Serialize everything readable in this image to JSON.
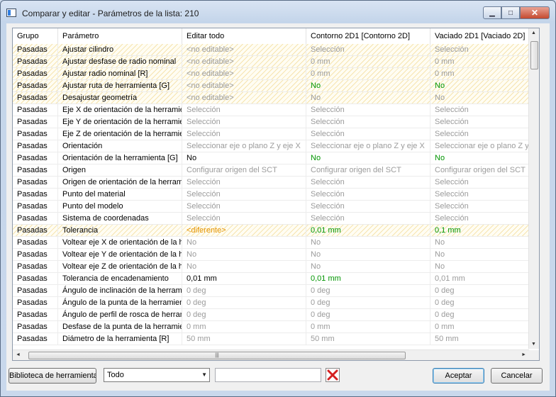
{
  "window": {
    "title": "Comparar y editar - Parámetros de la lista: 210",
    "minimize_label": "▁",
    "maximize_label": "□",
    "close_label": "✕"
  },
  "table": {
    "columns": [
      "Grupo",
      "Parámetro",
      "Editar todo",
      "Contorno 2D1 [Contorno 2D]",
      "Vaciado 2D1 [Vaciado 2D]"
    ],
    "rows": [
      {
        "cells": [
          "Pasadas",
          "Ajustar cilindro",
          "<no editable>",
          "Selección",
          "Selección"
        ],
        "styles": [
          "black",
          "black",
          "gray",
          "gray",
          "gray"
        ],
        "hatched": true
      },
      {
        "cells": [
          "Pasadas",
          "Ajustar desfase de radio nominal",
          "<no editable>",
          "0 mm",
          "0 mm"
        ],
        "styles": [
          "black",
          "black",
          "gray",
          "gray",
          "gray"
        ],
        "hatched": true
      },
      {
        "cells": [
          "Pasadas",
          "Ajustar radio nominal [R]",
          "<no editable>",
          "0 mm",
          "0 mm"
        ],
        "styles": [
          "black",
          "black",
          "gray",
          "gray",
          "gray"
        ],
        "hatched": true
      },
      {
        "cells": [
          "Pasadas",
          "Ajustar ruta de herramienta [G]",
          "<no editable>",
          "No",
          "No"
        ],
        "styles": [
          "black",
          "black",
          "gray",
          "green",
          "green"
        ],
        "hatched": true
      },
      {
        "cells": [
          "Pasadas",
          "Desajustar geometría",
          "<no editable>",
          "No",
          "No"
        ],
        "styles": [
          "black",
          "black",
          "gray",
          "gray",
          "gray"
        ],
        "hatched": true
      },
      {
        "cells": [
          "Pasadas",
          "Eje X de orientación de la herramienta",
          "Selección",
          "Selección",
          "Selección"
        ],
        "styles": [
          "black",
          "black",
          "gray",
          "gray",
          "gray"
        ],
        "hatched": false
      },
      {
        "cells": [
          "Pasadas",
          "Eje Y de orientación de la herramienta",
          "Selección",
          "Selección",
          "Selección"
        ],
        "styles": [
          "black",
          "black",
          "gray",
          "gray",
          "gray"
        ],
        "hatched": false
      },
      {
        "cells": [
          "Pasadas",
          "Eje Z de orientación de la herramienta",
          "Selección",
          "Selección",
          "Selección"
        ],
        "styles": [
          "black",
          "black",
          "gray",
          "gray",
          "gray"
        ],
        "hatched": false
      },
      {
        "cells": [
          "Pasadas",
          "Orientación",
          "Seleccionar eje o plano Z y eje X",
          "Seleccionar eje o plano Z y eje X",
          "Seleccionar eje o plano Z y eje X"
        ],
        "styles": [
          "black",
          "black",
          "gray",
          "gray",
          "gray"
        ],
        "hatched": false
      },
      {
        "cells": [
          "Pasadas",
          "Orientación de la herramienta [G]",
          "No",
          "No",
          "No"
        ],
        "styles": [
          "black",
          "black",
          "black",
          "green",
          "green"
        ],
        "hatched": false
      },
      {
        "cells": [
          "Pasadas",
          "Origen",
          "Configurar origen del SCT",
          "Configurar origen del SCT",
          "Configurar origen del SCT"
        ],
        "styles": [
          "black",
          "black",
          "gray",
          "gray",
          "gray"
        ],
        "hatched": false
      },
      {
        "cells": [
          "Pasadas",
          "Origen de orientación de la herramienta",
          "Selección",
          "Selección",
          "Selección"
        ],
        "styles": [
          "black",
          "black",
          "gray",
          "gray",
          "gray"
        ],
        "hatched": false
      },
      {
        "cells": [
          "Pasadas",
          "Punto del material",
          "Selección",
          "Selección",
          "Selección"
        ],
        "styles": [
          "black",
          "black",
          "gray",
          "gray",
          "gray"
        ],
        "hatched": false
      },
      {
        "cells": [
          "Pasadas",
          "Punto del modelo",
          "Selección",
          "Selección",
          "Selección"
        ],
        "styles": [
          "black",
          "black",
          "gray",
          "gray",
          "gray"
        ],
        "hatched": false
      },
      {
        "cells": [
          "Pasadas",
          "Sistema de coordenadas",
          "Selección",
          "Selección",
          "Selección"
        ],
        "styles": [
          "black",
          "black",
          "gray",
          "gray",
          "gray"
        ],
        "hatched": false
      },
      {
        "cells": [
          "Pasadas",
          "Tolerancia",
          "<diferente>",
          "0,01 mm",
          "0,1 mm"
        ],
        "styles": [
          "black",
          "black",
          "orange",
          "green",
          "green"
        ],
        "hatched": true
      },
      {
        "cells": [
          "Pasadas",
          "Voltear eje X de orientación de la herramienta",
          "No",
          "No",
          "No"
        ],
        "styles": [
          "black",
          "black",
          "gray",
          "gray",
          "gray"
        ],
        "hatched": false
      },
      {
        "cells": [
          "Pasadas",
          "Voltear eje Y de orientación de la herramienta",
          "No",
          "No",
          "No"
        ],
        "styles": [
          "black",
          "black",
          "gray",
          "gray",
          "gray"
        ],
        "hatched": false
      },
      {
        "cells": [
          "Pasadas",
          "Voltear eje Z de orientación de la herramienta",
          "No",
          "No",
          "No"
        ],
        "styles": [
          "black",
          "black",
          "gray",
          "gray",
          "gray"
        ],
        "hatched": false
      },
      {
        "cells": [
          "Pasadas",
          "Tolerancia de encadenamiento",
          "0,01 mm",
          "0,01 mm",
          "0,01 mm"
        ],
        "styles": [
          "black",
          "black",
          "black",
          "green",
          "gray"
        ],
        "hatched": false
      },
      {
        "cells": [
          "Pasadas",
          "Ángulo de inclinación de la herramienta",
          "0 deg",
          "0 deg",
          "0 deg"
        ],
        "styles": [
          "black",
          "black",
          "gray",
          "gray",
          "gray"
        ],
        "hatched": false
      },
      {
        "cells": [
          "Pasadas",
          "Ángulo de la punta de la herramienta",
          "0 deg",
          "0 deg",
          "0 deg"
        ],
        "styles": [
          "black",
          "black",
          "gray",
          "gray",
          "gray"
        ],
        "hatched": false
      },
      {
        "cells": [
          "Pasadas",
          "Ángulo de perfil de rosca de herramienta",
          "0 deg",
          "0 deg",
          "0 deg"
        ],
        "styles": [
          "black",
          "black",
          "gray",
          "gray",
          "gray"
        ],
        "hatched": false
      },
      {
        "cells": [
          "Pasadas",
          "Desfase de la punta de la herramienta",
          "0 mm",
          "0 mm",
          "0 mm"
        ],
        "styles": [
          "black",
          "black",
          "gray",
          "gray",
          "gray"
        ],
        "hatched": false
      },
      {
        "cells": [
          "Pasadas",
          "Diámetro de la herramienta [R]",
          "50 mm",
          "50 mm",
          "50 mm"
        ],
        "styles": [
          "black",
          "black",
          "gray",
          "gray",
          "gray"
        ],
        "hatched": false
      }
    ]
  },
  "scrollbars": {
    "up": "▲",
    "down": "▼",
    "left": "◄",
    "right": "►",
    "grip": "|||"
  },
  "footer": {
    "library_button": "Biblioteca de herramientas",
    "filter_select": "Todo",
    "filter_dropdown": "▼",
    "search_value": "",
    "accept_button": "Aceptar",
    "cancel_button": "Cancelar"
  },
  "colors": {
    "no_editable": "#9b9b9b",
    "changed": "#009500",
    "different": "#e59500",
    "hatch": "#f6e4b0"
  }
}
